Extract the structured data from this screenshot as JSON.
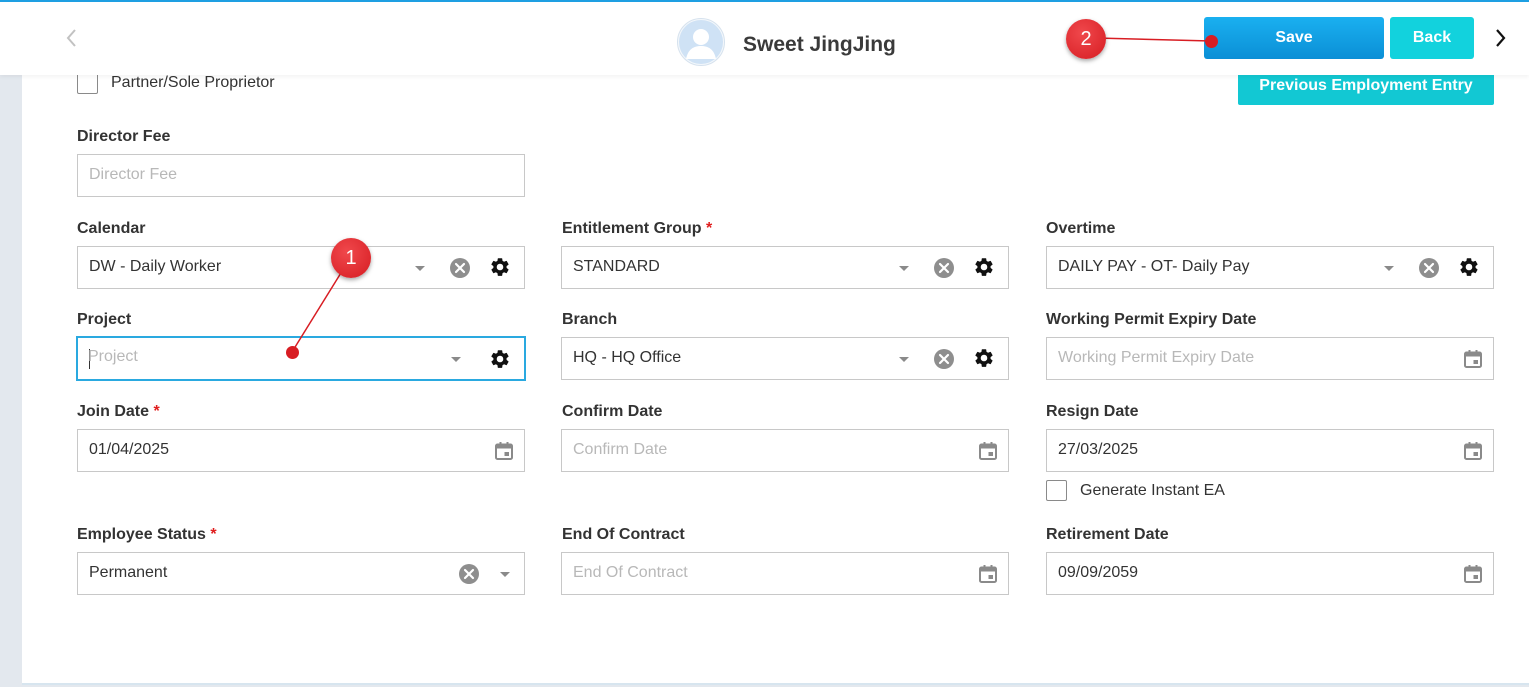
{
  "header": {
    "employee_name": "Sweet JingJing",
    "save_label": "Save",
    "back_label": "Back"
  },
  "actions": {
    "previous_employment_label": "Previous Employment Entry"
  },
  "partner": {
    "label": "Partner/Sole Proprietor",
    "checked": false
  },
  "director_fee": {
    "label": "Director Fee",
    "placeholder": "Director Fee",
    "value": ""
  },
  "calendar": {
    "label": "Calendar",
    "value": "DW - Daily Worker"
  },
  "entitlement_group": {
    "label": "Entitlement Group",
    "required_mark": "*",
    "value": "STANDARD"
  },
  "overtime": {
    "label": "Overtime",
    "value": "DAILY PAY - OT- Daily Pay"
  },
  "project": {
    "label": "Project",
    "placeholder": "Project",
    "value": ""
  },
  "branch": {
    "label": "Branch",
    "value": "HQ - HQ Office"
  },
  "working_permit_expiry": {
    "label": "Working Permit Expiry Date",
    "placeholder": "Working Permit Expiry Date",
    "value": ""
  },
  "join_date": {
    "label": "Join Date",
    "required_mark": "*",
    "value": "01/04/2025"
  },
  "confirm_date": {
    "label": "Confirm Date",
    "placeholder": "Confirm Date",
    "value": ""
  },
  "resign_date": {
    "label": "Resign Date",
    "value": "27/03/2025"
  },
  "generate_instant_ea": {
    "label": "Generate Instant EA",
    "checked": false
  },
  "employee_status": {
    "label": "Employee Status",
    "required_mark": "*",
    "value": "Permanent"
  },
  "end_of_contract": {
    "label": "End Of Contract",
    "placeholder": "End Of Contract",
    "value": ""
  },
  "retirement_date": {
    "label": "Retirement Date",
    "value": "09/09/2059"
  },
  "annotations": [
    {
      "number": "1"
    },
    {
      "number": "2"
    }
  ],
  "colors": {
    "primary": "#0b8fd6",
    "accent_cyan": "#12d2dd",
    "required": "#e01e1e",
    "annotation_red": "#d81d23",
    "focus_border": "#2aa9e0"
  },
  "icons": {
    "nav_prev": "chevron-left-icon",
    "nav_next": "chevron-right-icon",
    "avatar": "user-avatar-icon",
    "dropdown": "caret-down-icon",
    "clear": "clear-circle-icon",
    "settings": "gear-icon",
    "date": "calendar-icon"
  }
}
